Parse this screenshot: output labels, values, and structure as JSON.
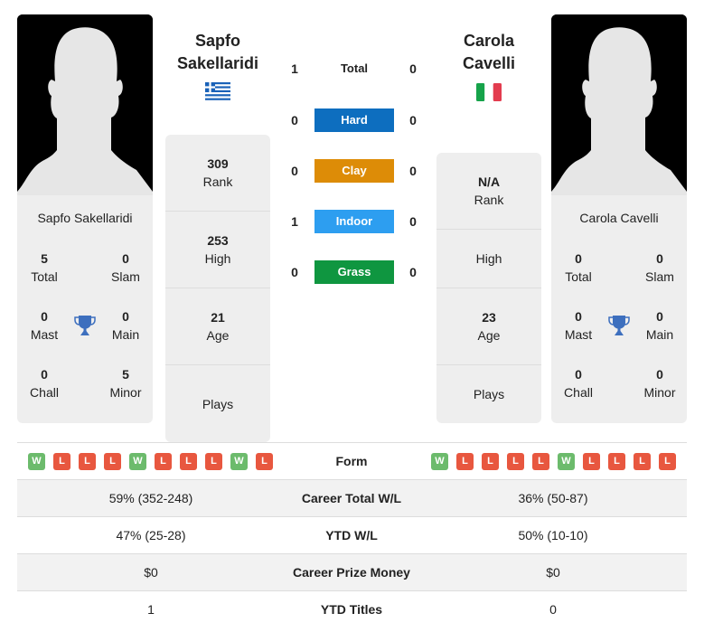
{
  "player1": {
    "name_line1": "Sapfo",
    "name_line2": "Sakellaridi",
    "full_name": "Sapfo Sakellaridi",
    "country": "Greece",
    "flag_icon": "greece-flag-icon",
    "titles": {
      "total": {
        "value": "5",
        "label": "Total"
      },
      "slam": {
        "value": "0",
        "label": "Slam"
      },
      "mast": {
        "value": "0",
        "label": "Mast"
      },
      "main": {
        "value": "0",
        "label": "Main"
      },
      "chall": {
        "value": "0",
        "label": "Chall"
      },
      "minor": {
        "value": "5",
        "label": "Minor"
      }
    },
    "stats": {
      "rank": {
        "value": "309",
        "label": "Rank"
      },
      "high": {
        "value": "253",
        "label": "High"
      },
      "age": {
        "value": "21",
        "label": "Age"
      },
      "plays": {
        "value": "",
        "label": "Plays"
      }
    },
    "form": [
      "W",
      "L",
      "L",
      "L",
      "W",
      "L",
      "L",
      "L",
      "W",
      "L"
    ]
  },
  "player2": {
    "name_line1": "Carola",
    "name_line2": "Cavelli",
    "full_name": "Carola Cavelli",
    "country": "Italy",
    "flag_icon": "italy-flag-icon",
    "titles": {
      "total": {
        "value": "0",
        "label": "Total"
      },
      "slam": {
        "value": "0",
        "label": "Slam"
      },
      "mast": {
        "value": "0",
        "label": "Mast"
      },
      "main": {
        "value": "0",
        "label": "Main"
      },
      "chall": {
        "value": "0",
        "label": "Chall"
      },
      "minor": {
        "value": "0",
        "label": "Minor"
      }
    },
    "stats": {
      "rank": {
        "value": "N/A",
        "label": "Rank"
      },
      "high": {
        "value": "",
        "label": "High"
      },
      "age": {
        "value": "23",
        "label": "Age"
      },
      "plays": {
        "value": "",
        "label": "Plays"
      }
    },
    "form": [
      "W",
      "L",
      "L",
      "L",
      "L",
      "W",
      "L",
      "L",
      "L",
      "L"
    ]
  },
  "h2h": [
    {
      "label": "Total",
      "left": "1",
      "right": "0",
      "color": ""
    },
    {
      "label": "Hard",
      "left": "0",
      "right": "0",
      "color": "#0d6ebf"
    },
    {
      "label": "Clay",
      "left": "0",
      "right": "0",
      "color": "#dd8c07"
    },
    {
      "label": "Indoor",
      "left": "1",
      "right": "0",
      "color": "#2d9ef0"
    },
    {
      "label": "Grass",
      "left": "0",
      "right": "0",
      "color": "#0f9640"
    }
  ],
  "form_label": "Form",
  "comparison": [
    {
      "label": "Career Total W/L",
      "left": "59% (352-248)",
      "right": "36% (50-87)"
    },
    {
      "label": "YTD W/L",
      "left": "47% (25-28)",
      "right": "50% (10-10)"
    },
    {
      "label": "Career Prize Money",
      "left": "$0",
      "right": "$0"
    },
    {
      "label": "YTD Titles",
      "left": "1",
      "right": "0"
    }
  ],
  "colors": {
    "win": "#6cbb6c",
    "loss": "#e8573f",
    "trophy": "#3d6fbe",
    "card_bg": "#eeeeee"
  }
}
